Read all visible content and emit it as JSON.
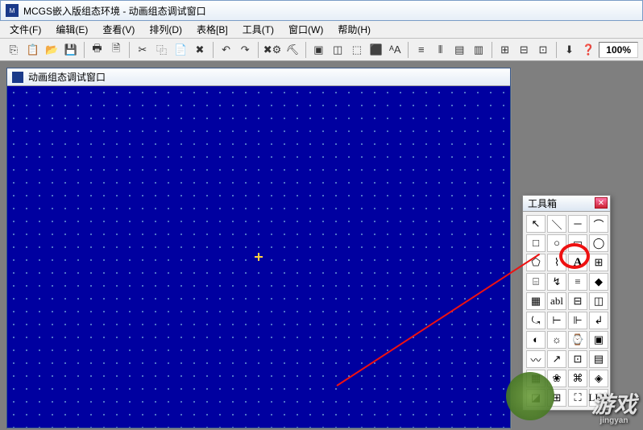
{
  "window": {
    "title": "MCGS嵌入版组态环境 - 动画组态调试窗口"
  },
  "menu": {
    "file": "文件(F)",
    "edit": "编辑(E)",
    "view": "查看(V)",
    "arrange": "排列(D)",
    "table": "表格[B]",
    "tool": "工具(T)",
    "window": "窗口(W)",
    "help": "帮助(H)"
  },
  "toolbar": {
    "zoom": "100%"
  },
  "child": {
    "title": "动画组态调试窗口"
  },
  "toolbox": {
    "title": "工具箱",
    "cells": [
      "↖",
      "＼",
      "─",
      "⌒",
      "□",
      "○",
      "▭",
      "◯",
      "⬠",
      "⌇",
      "A",
      "⊞",
      "⌸",
      "↯",
      "≡",
      "◆",
      "▦",
      "abl",
      "⊟",
      "◫",
      "⤿",
      "⊢",
      "⊩",
      "↲",
      "◐",
      "☼",
      "⌚",
      "▣",
      "〰",
      "↗",
      "⊡",
      "▤",
      "▦",
      "❀",
      "⌘",
      "◈",
      "◪",
      "⊞",
      "⛶",
      "LED"
    ]
  },
  "watermark": {
    "main": "游戏",
    "sub": "jingyan"
  }
}
